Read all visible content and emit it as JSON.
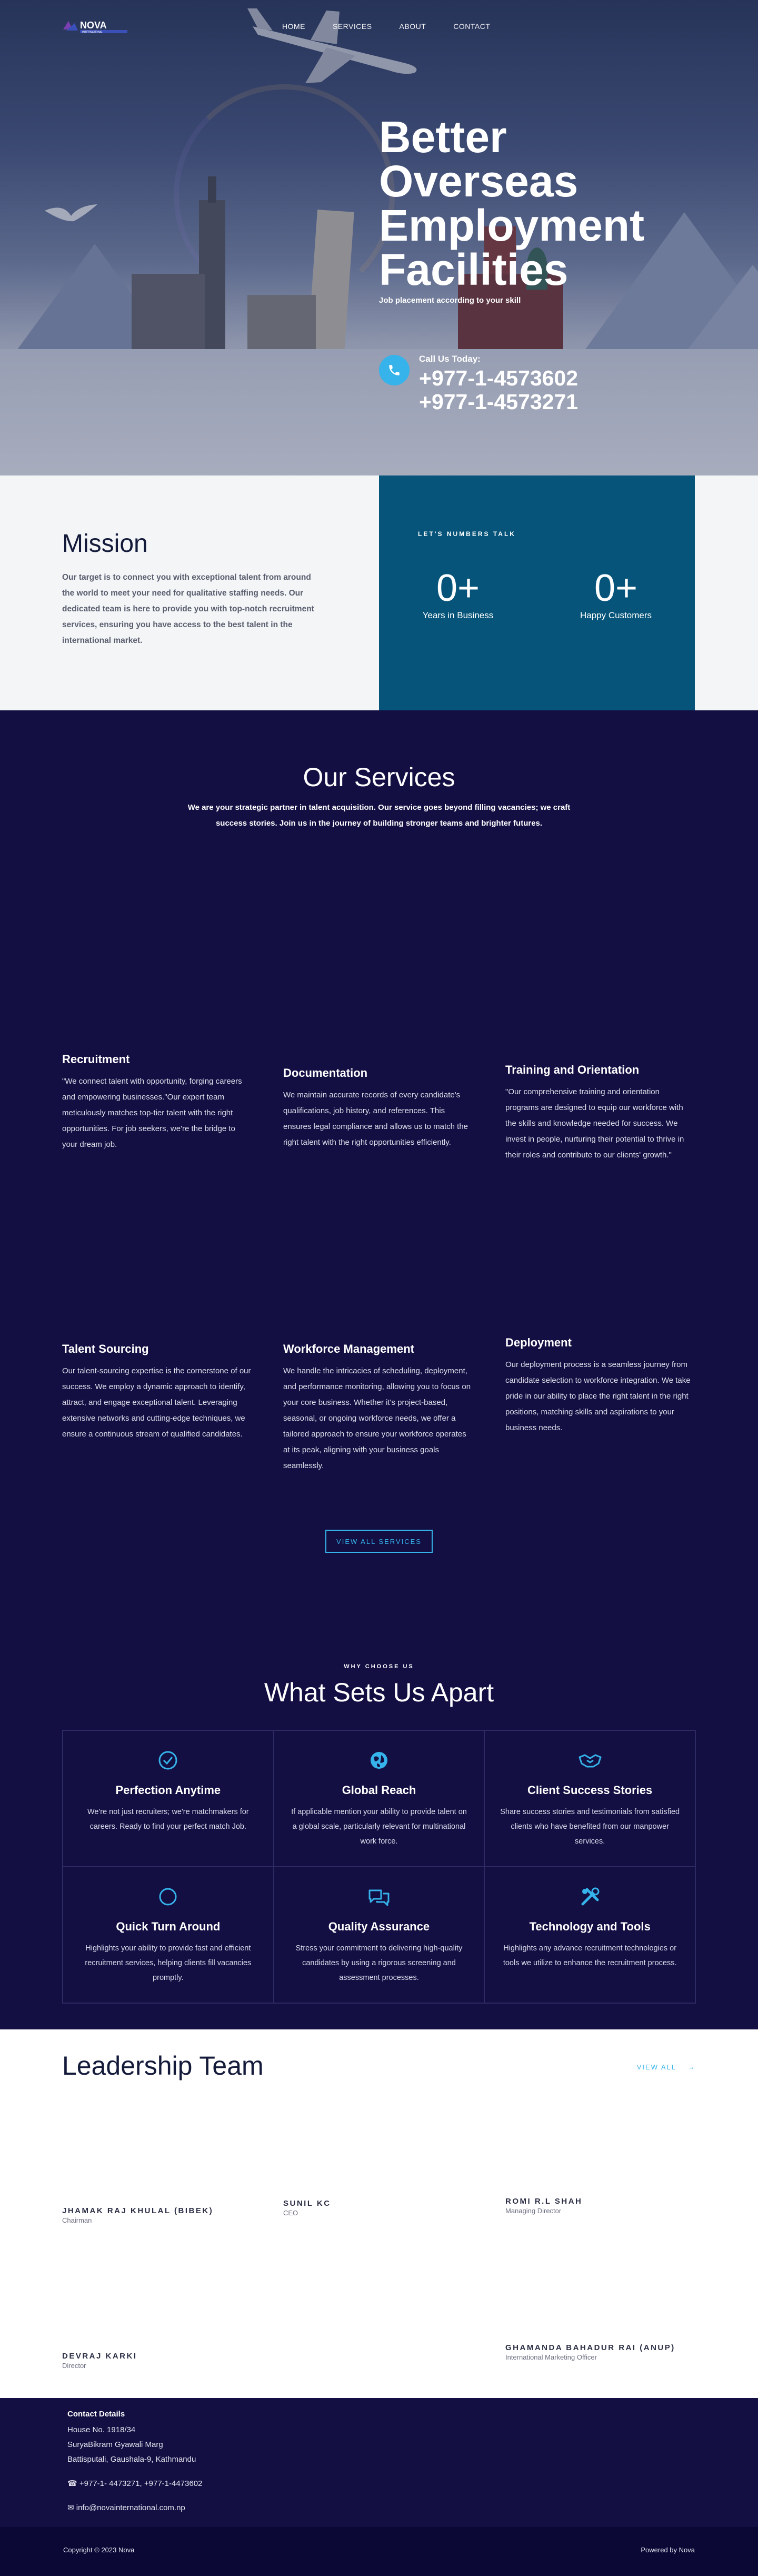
{
  "brand": {
    "name": "NOVA",
    "tagline": "INTERNATIONAL",
    "accent": "#35b3ea",
    "navy": "#130f43",
    "teal": "#065479"
  },
  "nav": {
    "links": [
      "HOME",
      "SERVICES",
      "ABOUT",
      "CONTACT"
    ]
  },
  "hero": {
    "title": "Better Overseas Employment Facilities",
    "subtitle": "Job placement according to your skill",
    "call_label": "Call Us Today:",
    "phones": [
      "+977-1-4573602",
      "+977-1-4573271"
    ]
  },
  "mission": {
    "title": "Mission",
    "text": "Our target is to connect you with exceptional talent from around the world to meet your need for qualitative staffing needs.   Our dedicated team is here to provide you with top-notch recruitment services, ensuring you have access to the best talent in the international market.",
    "numbers_label": "LET'S NUMBERS TALK",
    "stats": [
      {
        "value": "0+",
        "label": "Years in Business"
      },
      {
        "value": "0+",
        "label": "Happy Customers"
      }
    ]
  },
  "services": {
    "title": "Our Services",
    "intro": "We are your strategic partner in talent acquisition. Our service goes beyond filling vacancies; we craft success stories. Join us in the journey of building stronger teams and brighter futures.",
    "items": [
      {
        "title": "Recruitment",
        "text": "\"We connect talent with opportunity, forging careers and empowering businesses.\"Our expert team meticulously matches top-tier talent with the right opportunities. For job seekers, we're the bridge to your dream job."
      },
      {
        "title": "Documentation",
        "text": "We maintain accurate records of every candidate's qualifications, job history, and references. This ensures legal compliance and allows us to match the right talent with the right opportunities efficiently."
      },
      {
        "title": "Training and Orientation",
        "text": "\"Our comprehensive training and orientation programs are designed to equip our workforce with the skills and knowledge needed for success. We invest in people, nurturing their potential to thrive in their roles and contribute to our clients' growth.\""
      },
      {
        "title": "Talent Sourcing",
        "text": "Our talent-sourcing expertise is the cornerstone of our success. We employ a dynamic approach to identify, attract, and engage exceptional talent. Leveraging extensive networks and cutting-edge techniques, we ensure a continuous stream of qualified candidates."
      },
      {
        "title": "Workforce Management",
        "text": "We handle the intricacies of scheduling, deployment, and performance monitoring, allowing you to focus on your core business. Whether it's project-based, seasonal, or ongoing workforce needs, we offer a tailored approach to ensure your workforce operates at its peak, aligning with your business goals seamlessly."
      },
      {
        "title": "Deployment",
        "text": "Our deployment process is a seamless journey from candidate selection to workforce integration. We take pride in our ability to place the right talent in the right positions, matching skills and aspirations to your business needs."
      }
    ],
    "view_all": "VIEW ALL SERVICES"
  },
  "why": {
    "eyebrow": "WHY CHOOSE US",
    "title": "What Sets Us Apart",
    "items": [
      {
        "icon": "check-circle-icon",
        "title": "Perfection Anytime",
        "text": "We're not just recruiters; we're matchmakers for careers. Ready to find your perfect match Job."
      },
      {
        "icon": "globe-icon",
        "title": "Global Reach",
        "text": "If applicable mention your ability to provide talent on a global scale, particularly relevant for multinational work force."
      },
      {
        "icon": "handshake-icon",
        "title": "Client Success Stories",
        "text": "Share success stories and testimonials from satisfied clients who have benefited from our manpower services."
      },
      {
        "icon": "circle-icon",
        "title": "Quick Turn Around",
        "text": "Highlights your ability to provide fast and efficient recruitment services, helping clients fill vacancies promptly."
      },
      {
        "icon": "chat-icon",
        "title": "Quality Assurance",
        "text": "Stress your commitment to delivering high-quality candidates by using a rigorous screening and assessment processes."
      },
      {
        "icon": "tools-icon",
        "title": "Technology and Tools",
        "text": "Highlights any advance recruitment technologies or tools we utilize to enhance the recruitment process."
      }
    ]
  },
  "leadership": {
    "title": "Leadership Team",
    "view_all": "VIEW ALL",
    "members": [
      {
        "name": "JHAMAK RAJ KHULAL (BIBEK)",
        "role": "Chairman"
      },
      {
        "name": "SUNIL KC",
        "role": "CEO"
      },
      {
        "name": "ROMI R.L SHAH",
        "role": "Managing Director"
      },
      {
        "name": "DEVRAJ KARKI",
        "role": "Director"
      },
      {
        "name": "GHAMANDA BAHADUR RAI (ANUP)",
        "role": "International Marketing Officer"
      }
    ]
  },
  "contact": {
    "title": "Contact Details",
    "address": [
      "House No. 1918/34",
      "SuryaBikram Gyawali Marg",
      "Battisputali, Gaushala-9, Kathmandu"
    ],
    "phones": "+977-1- 4473271, +977-1-4473602",
    "email": "info@novainternational.com.np"
  },
  "footer": {
    "copyright": "Copyright © 2023 Nova",
    "powered": "Powered by Nova"
  }
}
